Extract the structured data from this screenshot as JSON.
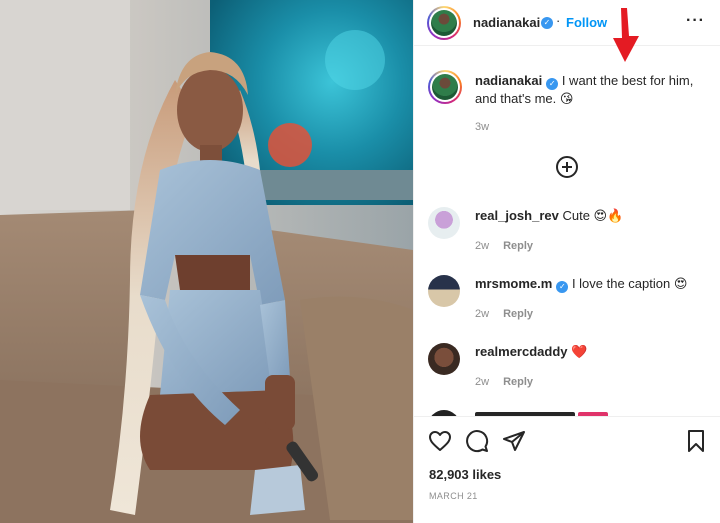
{
  "post": {
    "author": "nadianakai",
    "follow_label": "Follow",
    "more_label": "···",
    "verified_mark": "✓"
  },
  "caption": {
    "username": "nadianakai",
    "text": "I want the best for him, and that's me. 😘",
    "age": "3w"
  },
  "comments": [
    {
      "username": "real_josh_rev",
      "text": "Cute 😍🔥",
      "age": "2w",
      "reply_label": "Reply",
      "verified": false
    },
    {
      "username": "mrsmome.m",
      "text": "I love the caption 😍",
      "age": "2w",
      "reply_label": "Reply",
      "verified": true
    },
    {
      "username": "realmercdaddy",
      "text": "❤️",
      "age": "2w",
      "reply_label": "Reply",
      "verified": false
    }
  ],
  "actions": {
    "icons": [
      "heart-icon",
      "comment-icon",
      "share-icon",
      "bookmark-icon"
    ],
    "likes": "82,903 likes",
    "date": "MARCH 21"
  },
  "colors": {
    "accent": "#0095f6",
    "verified": "#3897f0",
    "annotation_arrow": "#e41b23"
  }
}
